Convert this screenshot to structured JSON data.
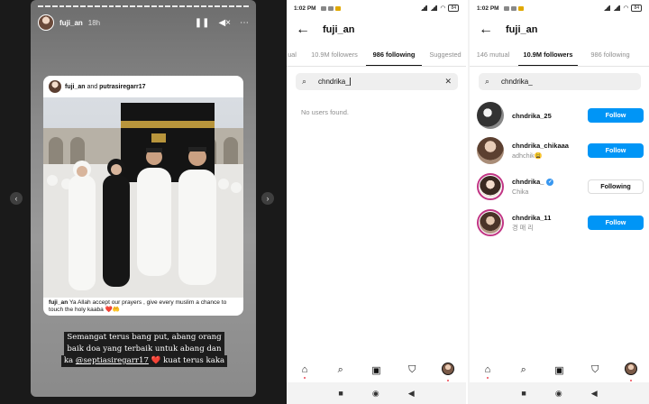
{
  "story": {
    "username": "fuji_an",
    "time": "18h",
    "post": {
      "author": "fuji_an",
      "and_text": "and",
      "coauthor": "putrasiregarr17",
      "caption_user": "fuji_an",
      "caption_text": "Ya Allah accept our prayers , give every muslim a chance to touch the holy kaaba ❤️🤲"
    },
    "text_lines": [
      "Semangat terus bang put, abang orang",
      "baik doa yang terbaik untuk abang dan"
    ],
    "text_line3_prefix": "ka ",
    "text_mention": "@septiasiregarr17",
    "text_line3_suffix": " ❤️ kuat terus kaka"
  },
  "status_bar": {
    "time": "1:02 PM",
    "battery": "84"
  },
  "screen1": {
    "title": "fuji_an",
    "tabs": [
      "ual",
      "10.9M followers",
      "986 following",
      "Suggested"
    ],
    "active_tab": 2,
    "search_value": "chndrika_",
    "empty_text": "No users found."
  },
  "screen2": {
    "title": "fuji_an",
    "tabs": [
      "146 mutual",
      "10.9M followers",
      "986 following"
    ],
    "active_tab": 1,
    "search_value": "chndrika_",
    "users": [
      {
        "username": "chndrika_25",
        "subtitle": "",
        "button": "Follow",
        "verified": false
      },
      {
        "username": "chndrika_chikaaa",
        "subtitle": "adhchik😩",
        "button": "Follow",
        "verified": false
      },
      {
        "username": "chndrika_",
        "subtitle": "Chika",
        "button": "Following",
        "verified": true
      },
      {
        "username": "chndrika_11",
        "subtitle": "경 매 리",
        "button": "Follow",
        "verified": false
      }
    ]
  },
  "colors": {
    "follow_blue": "#0095f6",
    "story_ring": "#c13584",
    "heart_red": "#ed4956"
  }
}
